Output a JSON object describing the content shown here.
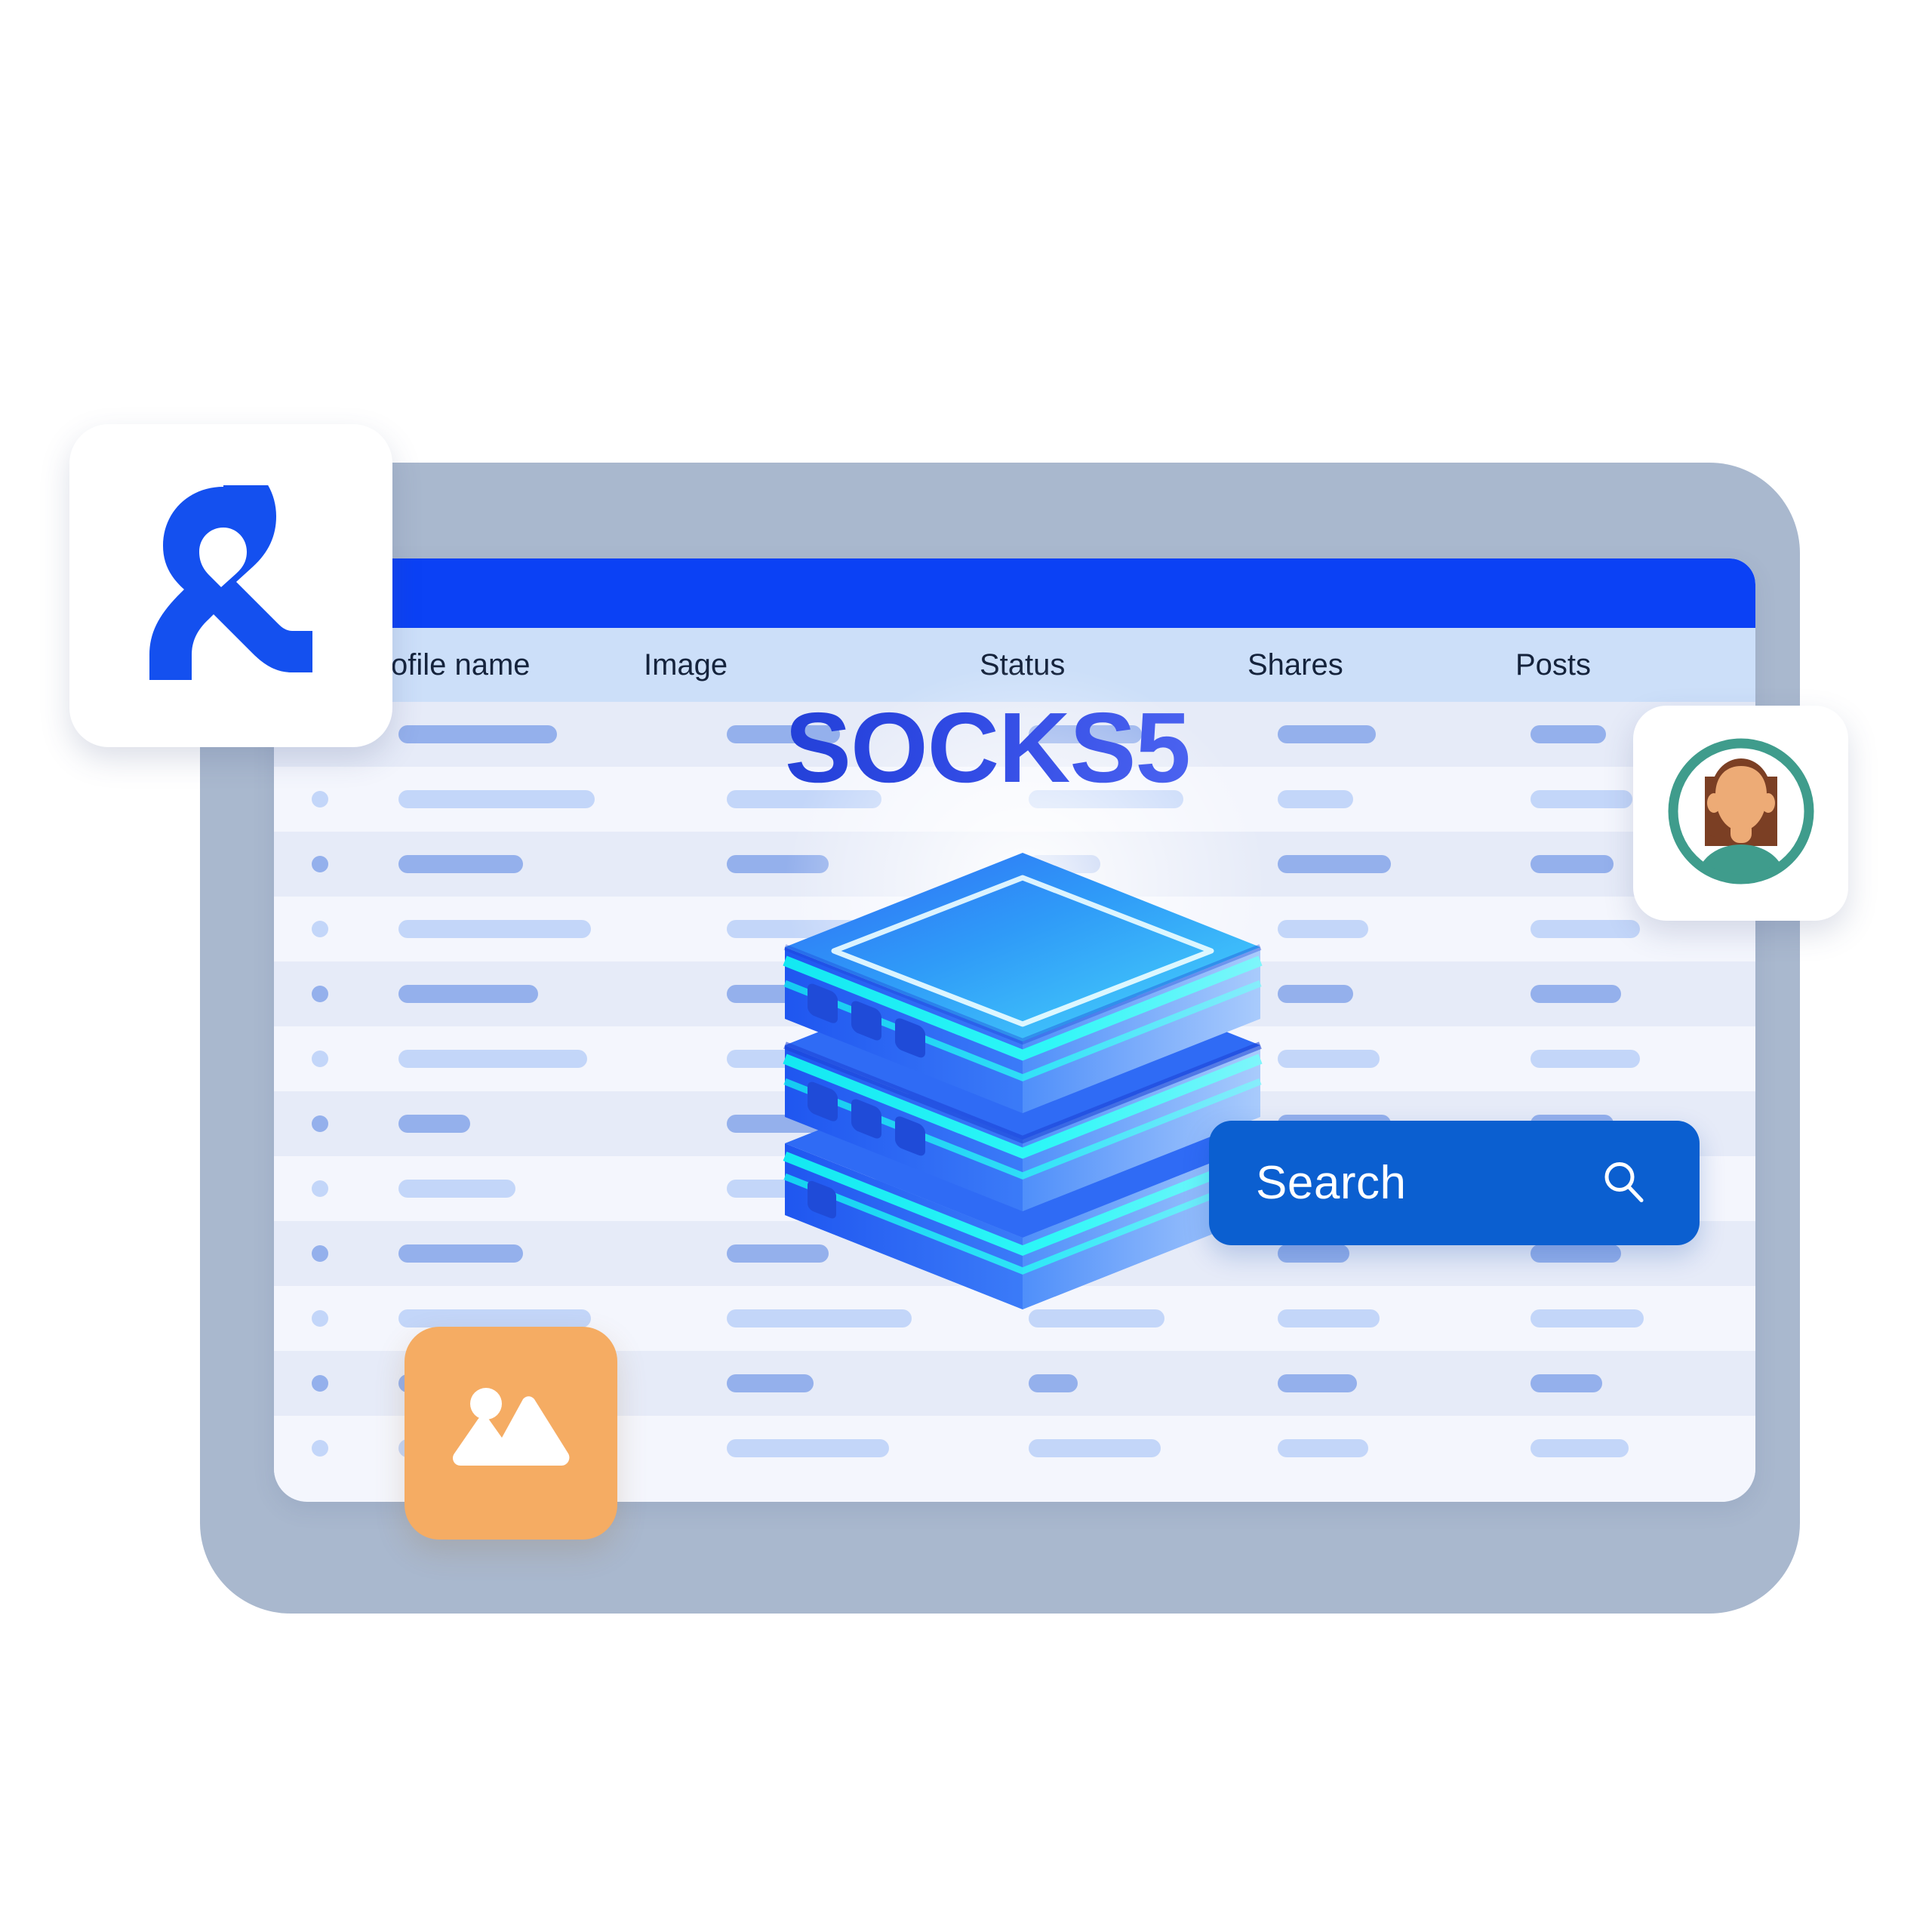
{
  "illustration": {
    "title": "SOCKS5",
    "headline_colors": {
      "from": "#2340d8",
      "to": "#4b63f0"
    }
  },
  "window": {
    "titlebar_color": "#0b41f5",
    "frame_color": "#a9b8ce",
    "header_row_color": "#ccdff9",
    "table": {
      "columns": [
        {
          "label": "ofile name"
        },
        {
          "label": "Image"
        },
        {
          "label": "Status"
        },
        {
          "label": "Shares"
        },
        {
          "label": "Posts"
        }
      ],
      "row_count": 12,
      "row_colors": {
        "odd": "#e6ebf8",
        "even": "#f4f6fd"
      },
      "placeholder_colors": {
        "odd": "#94b0ec",
        "even": "#c3d6f9"
      },
      "rows": [
        {
          "bars": [
            210,
            150,
            150,
            130,
            100
          ]
        },
        {
          "bars": [
            260,
            205,
            205,
            100,
            135
          ]
        },
        {
          "bars": [
            165,
            135,
            95,
            150,
            110
          ]
        },
        {
          "bars": [
            255,
            245,
            170,
            120,
            145
          ]
        },
        {
          "bars": [
            185,
            165,
            130,
            100,
            120
          ]
        },
        {
          "bars": [
            250,
            215,
            205,
            135,
            145
          ]
        },
        {
          "bars": [
            95,
            130,
            115,
            150,
            110
          ]
        },
        {
          "bars": [
            155,
            170,
            170,
            120,
            145
          ]
        },
        {
          "bars": [
            165,
            135,
            115,
            95,
            120
          ]
        },
        {
          "bars": [
            255,
            245,
            180,
            135,
            150
          ]
        },
        {
          "bars": [
            120,
            115,
            65,
            105,
            95
          ]
        },
        {
          "bars": [
            250,
            215,
            175,
            120,
            130
          ]
        }
      ]
    }
  },
  "search": {
    "label": "Search",
    "icon": "magnifier-icon",
    "color": "#0b5fd0"
  },
  "badges": {
    "logo": {
      "icon": "ampersand-logo-icon",
      "color": "#1450ef"
    },
    "avatar": {
      "icon": "user-avatar-icon",
      "ring_color": "#3f9c8c",
      "skin_color": "#edab76",
      "hair_color": "#7b3f24",
      "shirt_color": "#3f9c8c"
    },
    "image": {
      "icon": "image-picture-icon",
      "color": "#f5ac63"
    }
  },
  "server_stack": {
    "icon": "server-database-stack-icon",
    "tiers": 3,
    "glow_color": "#2ef0f0",
    "body_from": "#2f6bf5",
    "body_to": "#9ec2fb",
    "top_from": "#2f8df5",
    "top_to": "#3fd2f8",
    "led_color": "#1f4bd8"
  }
}
